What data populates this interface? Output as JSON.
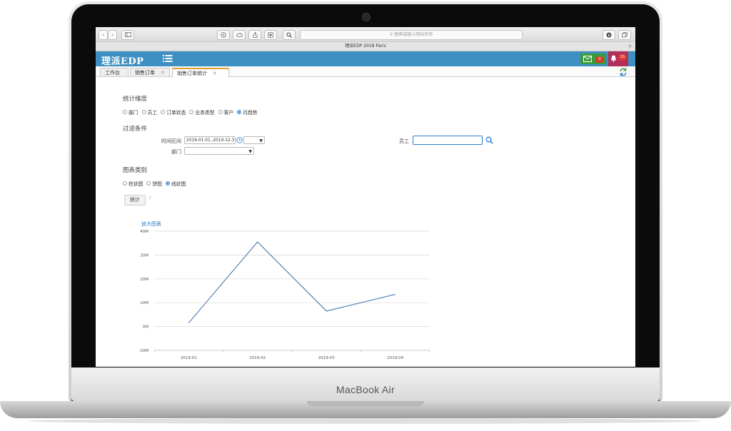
{
  "device": {
    "brand_label": "MacBook Air"
  },
  "browser": {
    "search_placeholder": "搜索或输入网站名称",
    "window_title": "理派EDP 2018 Paris"
  },
  "app": {
    "logo_text": "理派EDP",
    "header_color": "#3d8fc4",
    "mail_count": "0",
    "notification_count": "15"
  },
  "tabs": [
    {
      "label": "工作台",
      "closable": false
    },
    {
      "label": "销售订单",
      "closable": true
    },
    {
      "label": "销售订单统计",
      "closable": true,
      "active": true
    }
  ],
  "form": {
    "dimension_title": "统计维度",
    "dimension_options": [
      "部门",
      "员工",
      "订单状态",
      "业务类型",
      "客户",
      "月趋势"
    ],
    "dimension_selected": "月趋势",
    "filter_title": "过滤条件",
    "time_range_label": "时间区间",
    "time_range_value": "2019-01-01..2019-12-31",
    "department_label": "部门",
    "department_value": "",
    "employee_label": "员工",
    "employee_value": "",
    "chart_type_title": "图表类别",
    "chart_type_options": [
      "柱状图",
      "饼图",
      "线状图"
    ],
    "chart_type_selected": "线状图",
    "submit_label": "统计",
    "help_mark": "?",
    "zoom_link": "放大图表"
  },
  "chart_data": {
    "type": "line",
    "title": "",
    "xlabel": "",
    "ylabel": "",
    "categories": [
      "2019-01",
      "2019-02",
      "2019-03",
      "2019-04"
    ],
    "series": [
      {
        "values": [
          1.5,
          35.5,
          6.5,
          13.5
        ],
        "color": "#3a6ea8"
      }
    ],
    "y_ticks": [
      "-10M",
      "0M",
      "10M",
      "20M",
      "30M",
      "40M"
    ],
    "ylim": [
      -10,
      40
    ],
    "y_unit": "M",
    "grid": true,
    "legend": "none"
  }
}
